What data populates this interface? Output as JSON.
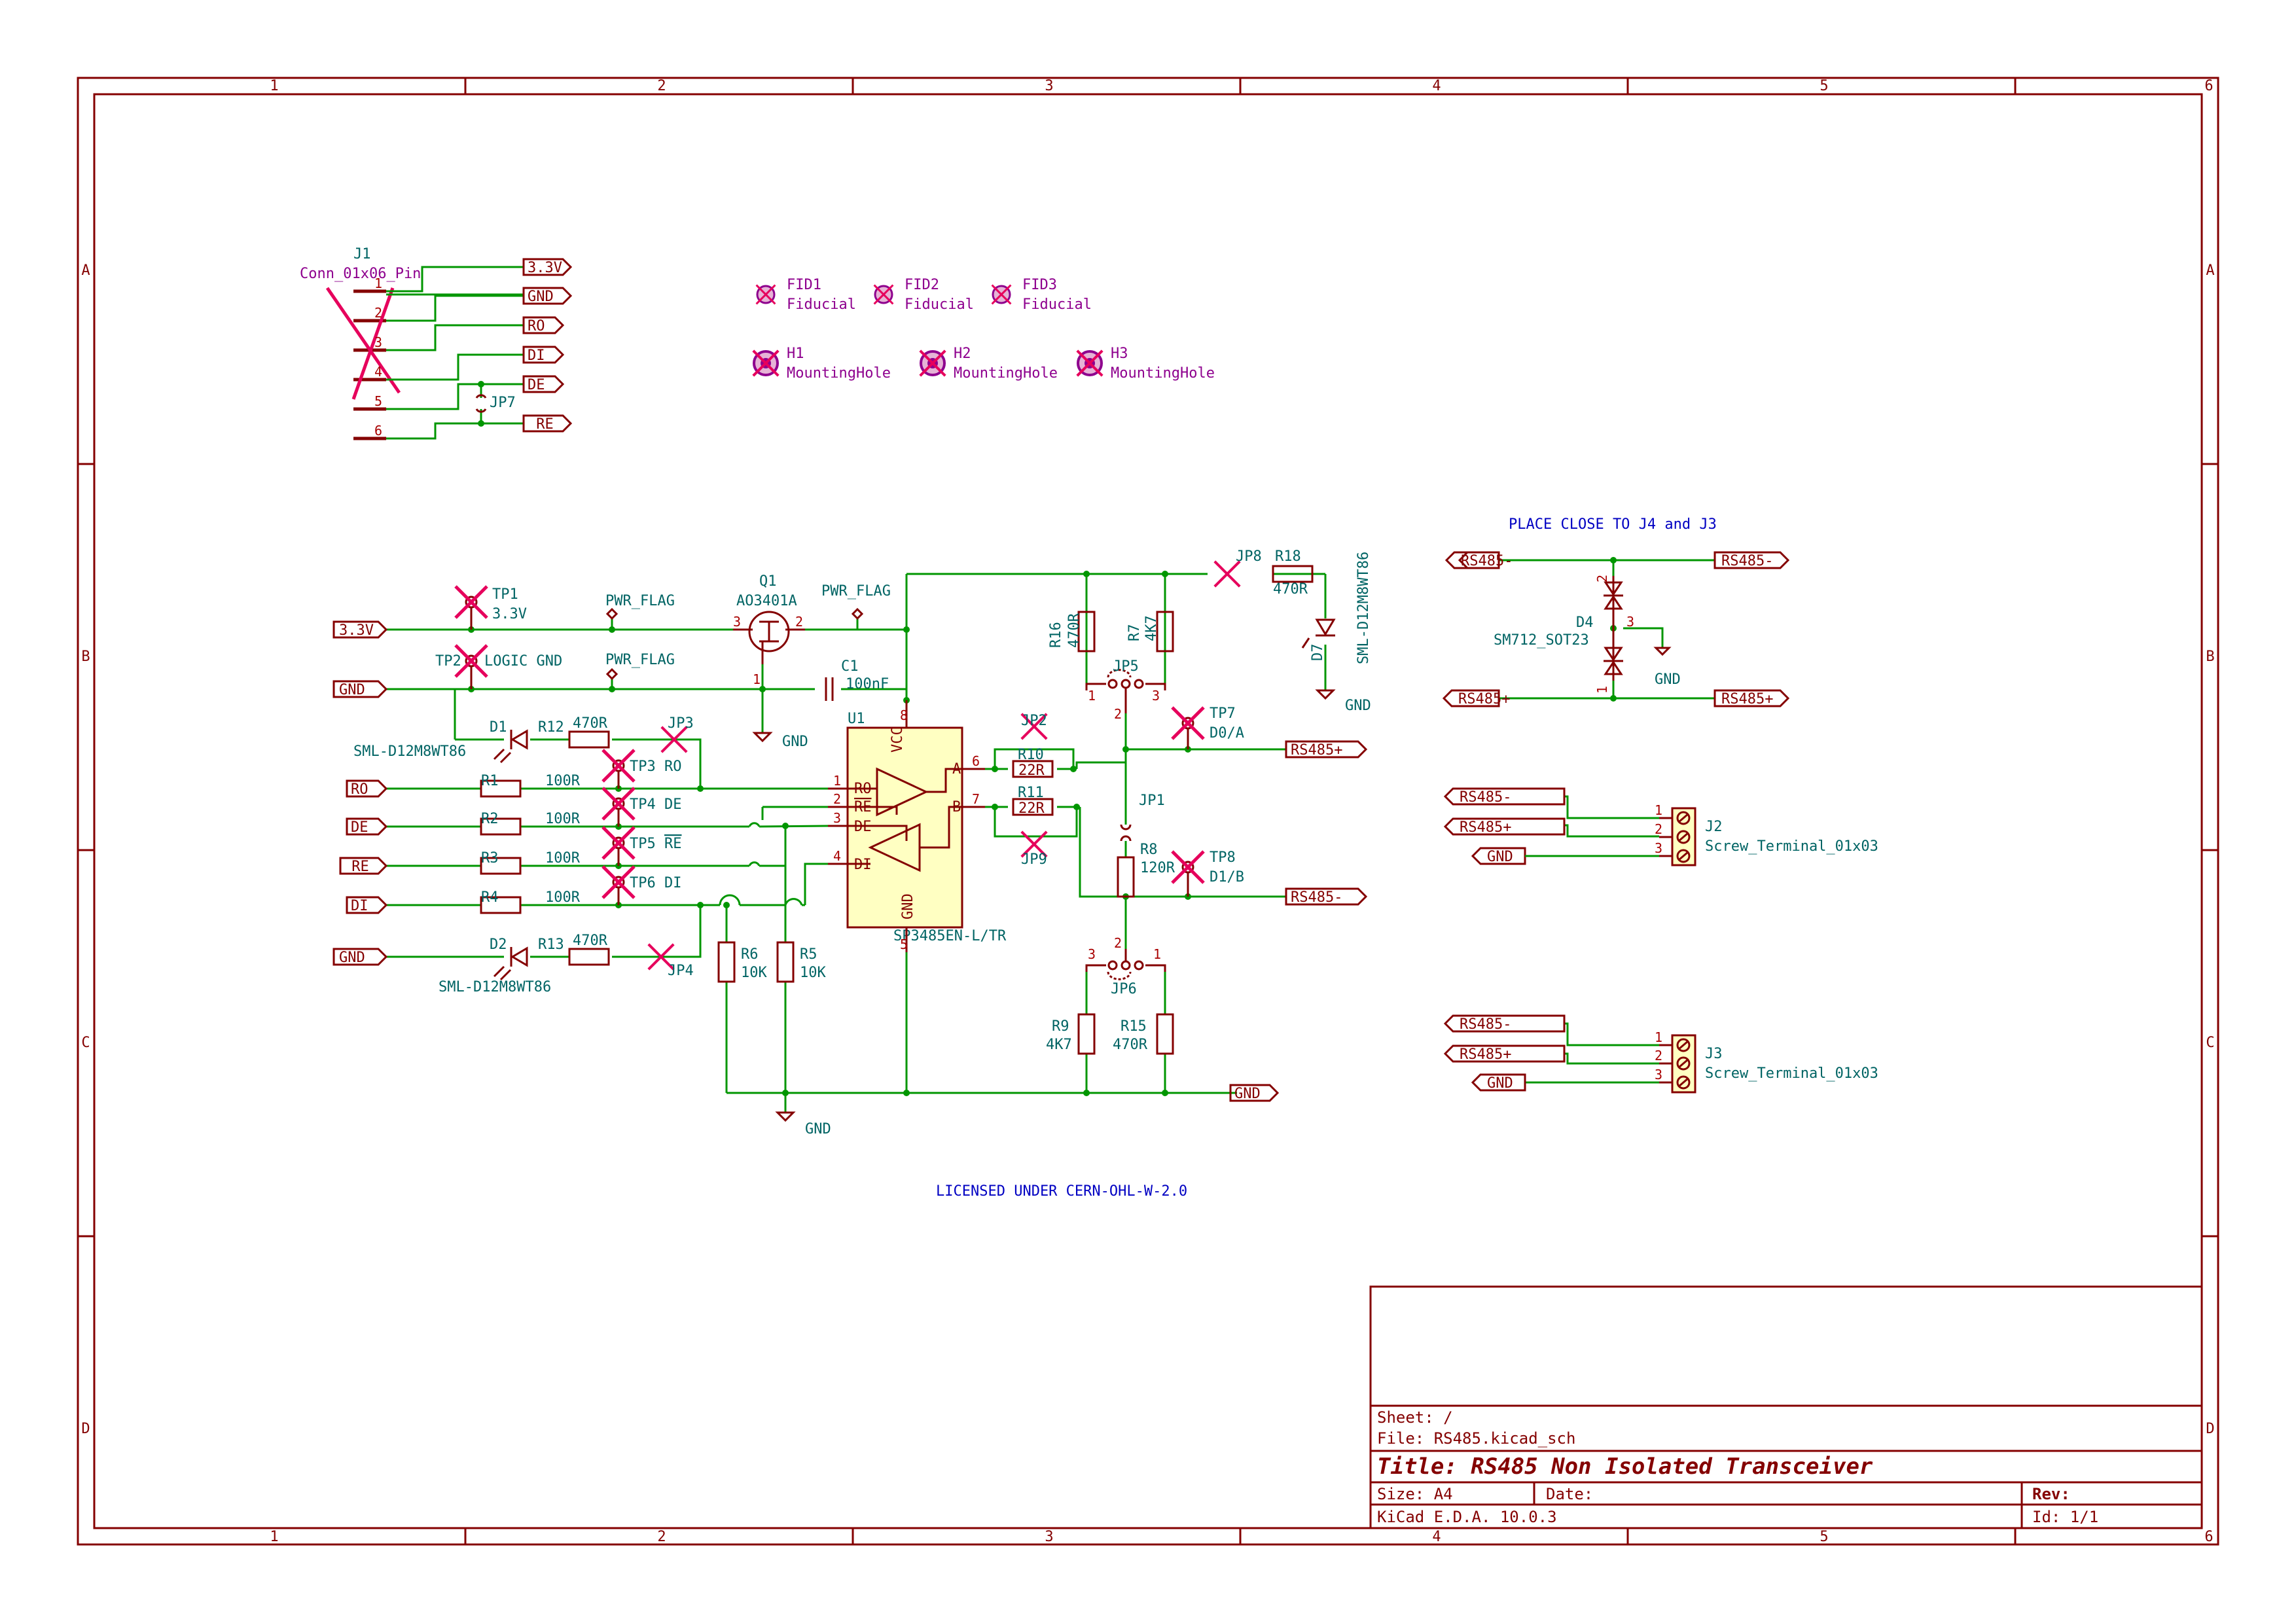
{
  "colors": {
    "border": "#840000",
    "wire": "#009600",
    "component": "#840000",
    "component_fill": "#ffffc2",
    "ref": "#006464",
    "value": "#006464",
    "pin_number": "#a90000",
    "label": "#840000",
    "junction": "#009600",
    "note": "#0000c2",
    "dnp": "#e6005c",
    "dnp_text": "#8e008e"
  },
  "frame": {
    "columns": [
      "1",
      "2",
      "3",
      "4",
      "5",
      "6"
    ],
    "rows": [
      "A",
      "B",
      "C",
      "D"
    ]
  },
  "title_block": {
    "sheet": "Sheet: /",
    "file": "File: RS485.kicad_sch",
    "title": "Title: RS485 Non Isolated Transceiver",
    "size": "Size: A4",
    "date": "Date:",
    "rev": "Rev:",
    "tool": "KiCad E.D.A. 10.0.3",
    "id": "Id: 1/1"
  },
  "notes": {
    "place_close": "PLACE CLOSE TO J4 and J3",
    "license": "LICENSED UNDER CERN-OHL-W-2.0"
  },
  "connector_j1": {
    "ref": "J1",
    "value": "Conn_01x06_Pin",
    "pins": [
      "1",
      "2",
      "3",
      "4",
      "5",
      "6"
    ],
    "labels": [
      "3.3V",
      "GND",
      "RO",
      "DI",
      "DE",
      "_RE"
    ],
    "jumper": "JP7"
  },
  "fiducials": [
    {
      "ref": "FID1",
      "value": "Fiducial"
    },
    {
      "ref": "FID2",
      "value": "Fiducial"
    },
    {
      "ref": "FID3",
      "value": "Fiducial"
    }
  ],
  "mounting_holes": [
    {
      "ref": "H1",
      "value": "MountingHole"
    },
    {
      "ref": "H2",
      "value": "MountingHole"
    },
    {
      "ref": "H3",
      "value": "MountingHole"
    }
  ],
  "power": {
    "in_3v3": "3.3V",
    "in_gnd": "GND",
    "tp1_ref": "TP1",
    "tp1_val": "3.3V",
    "tp2_ref": "TP2",
    "tp2_val": "LOGIC GND",
    "pwr_flag": "PWR_FLAG",
    "q1_ref": "Q1",
    "q1_val": "AO3401A",
    "c1_ref": "C1",
    "c1_val": "100nF",
    "gnd": "GND"
  },
  "ic": {
    "ref": "U1",
    "value": "SP3485EN-L/TR",
    "pins": {
      "ro": "RO",
      "re": "RE",
      "de": "DE",
      "di": "DI",
      "vcc": "VCC",
      "gnd": "GND",
      "a": "A",
      "b": "B"
    },
    "pin_numbers": {
      "p1": "1",
      "p2": "2",
      "p3": "3",
      "p4": "4",
      "p5": "5",
      "p6": "6",
      "p7": "7",
      "p8": "8"
    }
  },
  "logic_side": {
    "labels": [
      "RO",
      "DE",
      "_RE",
      "DI"
    ],
    "resistors": [
      {
        "ref": "R1",
        "value": "100R"
      },
      {
        "ref": "R2",
        "value": "100R"
      },
      {
        "ref": "R3",
        "value": "100R"
      },
      {
        "ref": "R4",
        "value": "100R"
      }
    ],
    "testpoints": [
      "TP3 RO",
      "TP4 DE",
      "TP5 ",
      "TP6 DI"
    ],
    "tp5_overbar": "RE",
    "r5": {
      "ref": "R5",
      "value": "10K"
    },
    "r6": {
      "ref": "R6",
      "value": "10K"
    },
    "d1": {
      "ref": "D1",
      "value": "SML-D12M8WT86"
    },
    "d2": {
      "ref": "D2",
      "value": "SML-D12M8WT86"
    },
    "r12": {
      "ref": "R12",
      "value": "470R"
    },
    "r13": {
      "ref": "R13",
      "value": "470R"
    },
    "jp3": "JP3",
    "jp4": "JP4"
  },
  "bus_side": {
    "jp2": "JP2",
    "jp9": "JP9",
    "r10": {
      "ref": "R10",
      "value": "22R"
    },
    "r11": {
      "ref": "R11",
      "value": "22R"
    },
    "r16": {
      "ref": "R16",
      "value": "470R"
    },
    "r7": {
      "ref": "R7",
      "value": "4K7"
    },
    "r8": {
      "ref": "R8",
      "value": "120R"
    },
    "r9": {
      "ref": "R9",
      "value": "4K7"
    },
    "r15": {
      "ref": "R15",
      "value": "470R"
    },
    "r18": {
      "ref": "R18",
      "value": "470R"
    },
    "jp1": "JP1",
    "jp5": "JP5",
    "jp6": "JP6",
    "jp8": "JP8",
    "tp7_ref": "TP7",
    "tp7_val": "D0/A",
    "tp8_ref": "TP8",
    "tp8_val": "D1/B",
    "d7": {
      "ref": "D7",
      "value": "SML-D12M8WT86"
    },
    "rs485p": "RS485+",
    "rs485m": "RS485-",
    "gnd": "GND"
  },
  "tvs": {
    "ref": "D4",
    "value": "SM712_SOT23",
    "labels": [
      "RS485-",
      "RS485-",
      "RS485+",
      "RS485+"
    ],
    "gnd": "GND"
  },
  "terminals": [
    {
      "ref": "J2",
      "value": "Screw_Terminal_01x03",
      "labels": [
        "RS485-",
        "RS485+",
        "GND"
      ]
    },
    {
      "ref": "J3",
      "value": "Screw_Terminal_01x03",
      "labels": [
        "RS485-",
        "RS485+",
        "GND"
      ]
    }
  ]
}
